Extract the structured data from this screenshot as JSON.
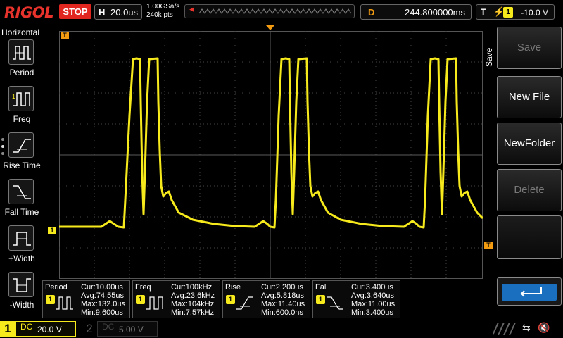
{
  "topbar": {
    "brand": "RIGOL",
    "run_state": "STOP",
    "timebase_label": "H",
    "timebase_value": "20.0us",
    "sample_rate": "1.00GSa/s",
    "memory_depth": "240k pts",
    "delay_label": "D",
    "delay_value": "244.800000ms",
    "trigger_label": "T",
    "trigger_channel": "1",
    "trigger_level": "-10.0 V",
    "colors": {
      "brand": "#e8332c",
      "stop": "#e0261f",
      "delay": "#f39c12"
    }
  },
  "left_menu": {
    "title": "Horizontal",
    "items": [
      {
        "label": "Period",
        "icon": "period-icon"
      },
      {
        "label": "Freq",
        "icon": "freq-icon"
      },
      {
        "label": "Rise Time",
        "icon": "rise-time-icon"
      },
      {
        "label": "Fall Time",
        "icon": "fall-time-icon"
      },
      {
        "label": "+Width",
        "icon": "pos-width-icon"
      },
      {
        "label": "-Width",
        "icon": "neg-width-icon"
      }
    ]
  },
  "right_menu": {
    "title": "Save",
    "buttons": [
      {
        "label": "Save",
        "enabled": false
      },
      {
        "label": "New File",
        "enabled": true
      },
      {
        "label": "NewFolder",
        "enabled": true
      },
      {
        "label": "Delete",
        "enabled": false
      }
    ],
    "enter_icon": "enter-icon"
  },
  "grid_markers": {
    "trigger_pos": "T",
    "channel_marker": "1",
    "trigger_level_marker": "T"
  },
  "measurements": [
    {
      "title": "Period",
      "channel": "1",
      "icon": "period-icon",
      "cur": "Cur:10.00us",
      "avg": "Avg:74.55us",
      "max": "Max:132.0us",
      "min": "Min:9.600us"
    },
    {
      "title": "Freq",
      "channel": "1",
      "icon": "freq-icon",
      "cur": "Cur:100kHz",
      "avg": "Avg:23.6kHz",
      "max": "Max:104kHz",
      "min": "Min:7.57kHz"
    },
    {
      "title": "Rise",
      "channel": "1",
      "icon": "rise-time-icon",
      "cur": "Cur:2.200us",
      "avg": "Avg:5.818us",
      "max": "Max:11.40us",
      "min": "Min:600.0ns"
    },
    {
      "title": "Fall",
      "channel": "1",
      "icon": "fall-time-icon",
      "cur": "Cur:3.400us",
      "avg": "Avg:3.640us",
      "max": "Max:11.00us",
      "min": "Min:3.400us"
    }
  ],
  "bottombar": {
    "ch1_number": "1",
    "ch1_coupling": "DC",
    "ch1_scale": "20.0 V",
    "ch2_number": "2",
    "ch2_coupling": "DC",
    "ch2_scale": "5.00 V",
    "usb_icon": "usb-icon",
    "speaker_icon": "speaker-muted-icon",
    "colors": {
      "ch1": "#f7ea1c"
    }
  }
}
